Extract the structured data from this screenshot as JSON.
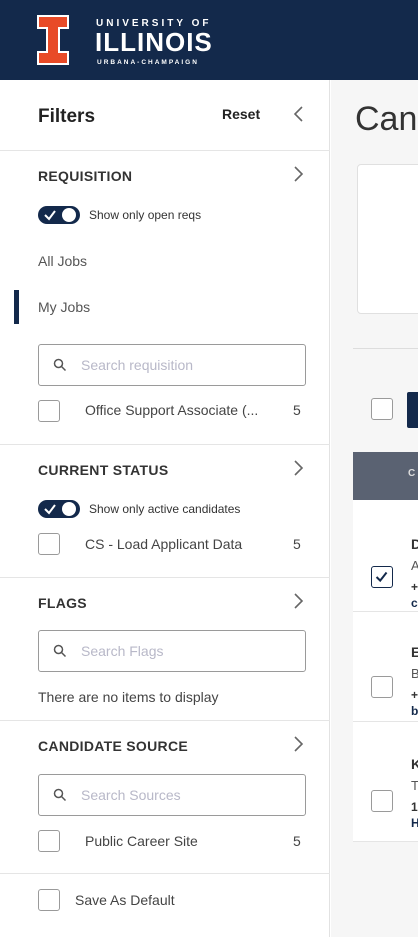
{
  "brand": {
    "line1": "UNIVERSITY OF",
    "line2": "ILLINOIS",
    "line3": "URBANA-CHAMPAIGN",
    "navy": "#13294b",
    "orange": "#e84a27"
  },
  "sidebar": {
    "title": "Filters",
    "reset_label": "Reset",
    "requisition": {
      "title": "REQUISITION",
      "toggle_label": "Show only open reqs",
      "toggle_on": true,
      "links": [
        "All Jobs",
        "My Jobs"
      ],
      "active_link": "My Jobs",
      "search_placeholder": "Search requisition",
      "items": [
        {
          "label": "Office Support Associate (...",
          "count": "5",
          "checked": false
        }
      ]
    },
    "current_status": {
      "title": "CURRENT STATUS",
      "toggle_label": "Show only active candidates",
      "toggle_on": true,
      "items": [
        {
          "label": "CS - Load Applicant Data",
          "count": "5",
          "checked": false
        }
      ]
    },
    "flags": {
      "title": "FLAGS",
      "search_placeholder": "Search Flags",
      "empty_message": "There are no items to display"
    },
    "candidate_source": {
      "title": "CANDIDATE SOURCE",
      "search_placeholder": "Search Sources",
      "items": [
        {
          "label": "Public Career Site",
          "count": "5",
          "checked": false
        }
      ]
    },
    "save_default_label": "Save As Default"
  },
  "main": {
    "title": "Can",
    "table_header": "C",
    "rows": [
      {
        "l1": "D",
        "l2": "A",
        "l3": "+",
        "l4": "c",
        "checked": true
      },
      {
        "l1": "E",
        "l2": "B",
        "l3": "+",
        "l4": "b",
        "checked": false
      },
      {
        "l1": "K",
        "l2": "T",
        "l3": "1",
        "l4": "H",
        "checked": false
      }
    ]
  }
}
